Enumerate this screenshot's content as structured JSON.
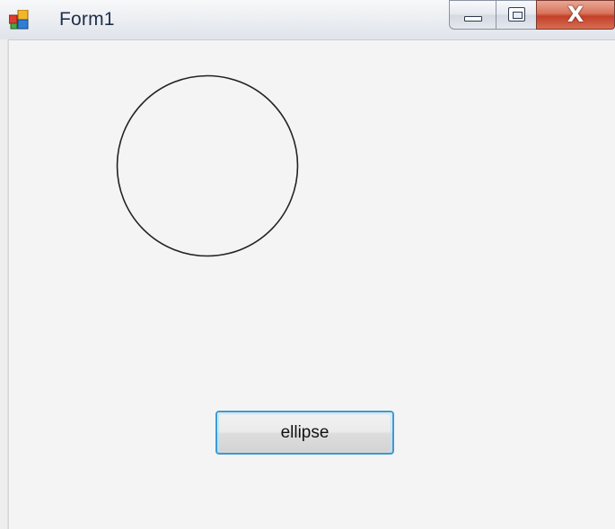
{
  "window": {
    "title": "Form1",
    "icon": "winforms-app-icon",
    "controls": {
      "minimize_icon": "minimize-icon",
      "maximize_icon": "maximize-icon",
      "close_label": "X"
    }
  },
  "form": {
    "button_label": "ellipse",
    "shape": "circle"
  },
  "colors": {
    "accent_border": "#3c9ad6",
    "close_button": "#c4402a",
    "client_background": "#f4f4f4",
    "shape_stroke": "#222222"
  }
}
